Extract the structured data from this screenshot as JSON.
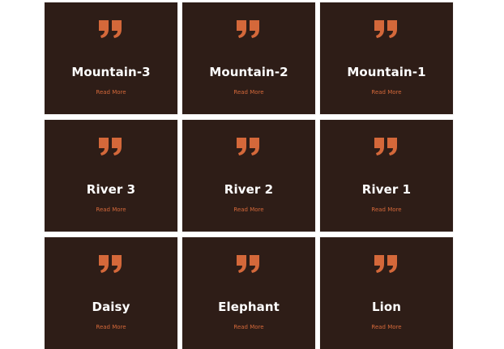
{
  "accent_color": "#d4683a",
  "card_background": "#2e1d17",
  "icon": "quote-icon",
  "cards": [
    {
      "title": "Mountain-3",
      "link_label": "Read More"
    },
    {
      "title": "Mountain-2",
      "link_label": "Read More"
    },
    {
      "title": "Mountain-1",
      "link_label": "Read More"
    },
    {
      "title": "River 3",
      "link_label": "Read More"
    },
    {
      "title": "River 2",
      "link_label": "Read More"
    },
    {
      "title": "River 1",
      "link_label": "Read More"
    },
    {
      "title": "Daisy",
      "link_label": "Read More"
    },
    {
      "title": "Elephant",
      "link_label": "Read More"
    },
    {
      "title": "Lion",
      "link_label": "Read More"
    }
  ]
}
